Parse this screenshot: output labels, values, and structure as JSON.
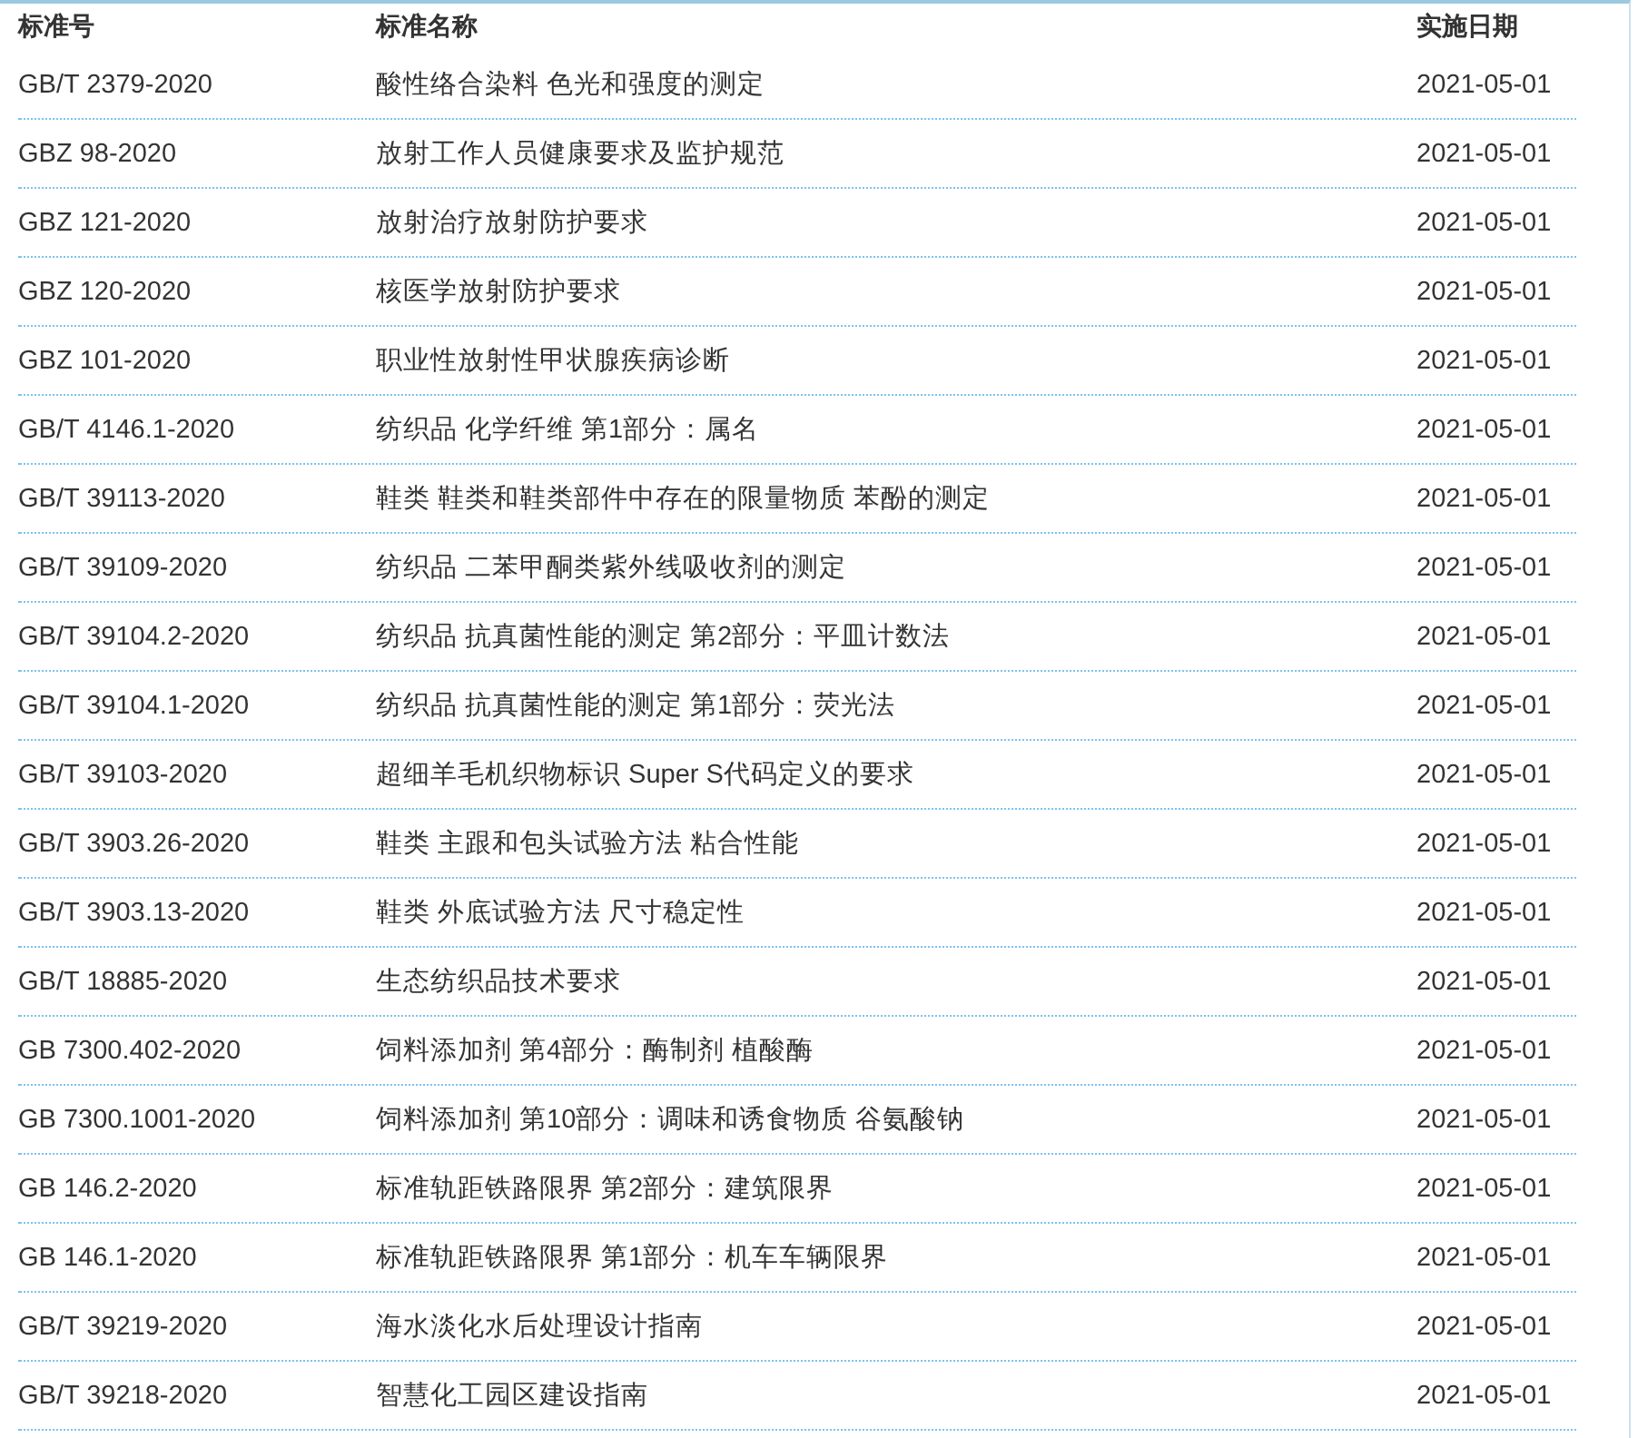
{
  "table": {
    "columns": [
      "标准号",
      "标准名称",
      "实施日期"
    ],
    "rows": [
      [
        "GB/T 2379-2020",
        "酸性络合染料 色光和强度的测定",
        "2021-05-01"
      ],
      [
        "GBZ 98-2020",
        "放射工作人员健康要求及监护规范",
        "2021-05-01"
      ],
      [
        "GBZ 121-2020",
        "放射治疗放射防护要求",
        "2021-05-01"
      ],
      [
        "GBZ 120-2020",
        "核医学放射防护要求",
        "2021-05-01"
      ],
      [
        "GBZ 101-2020",
        "职业性放射性甲状腺疾病诊断",
        "2021-05-01"
      ],
      [
        "GB/T 4146.1-2020",
        "纺织品 化学纤维 第1部分：属名",
        "2021-05-01"
      ],
      [
        "GB/T 39113-2020",
        "鞋类 鞋类和鞋类部件中存在的限量物质 苯酚的测定",
        "2021-05-01"
      ],
      [
        "GB/T 39109-2020",
        "纺织品 二苯甲酮类紫外线吸收剂的测定",
        "2021-05-01"
      ],
      [
        "GB/T 39104.2-2020",
        "纺织品 抗真菌性能的测定 第2部分：平皿计数法",
        "2021-05-01"
      ],
      [
        "GB/T 39104.1-2020",
        "纺织品 抗真菌性能的测定 第1部分：荧光法",
        "2021-05-01"
      ],
      [
        "GB/T 39103-2020",
        "超细羊毛机织物标识 Super S代码定义的要求",
        "2021-05-01"
      ],
      [
        "GB/T 3903.26-2020",
        "鞋类 主跟和包头试验方法 粘合性能",
        "2021-05-01"
      ],
      [
        "GB/T 3903.13-2020",
        "鞋类 外底试验方法 尺寸稳定性",
        "2021-05-01"
      ],
      [
        "GB/T 18885-2020",
        "生态纺织品技术要求",
        "2021-05-01"
      ],
      [
        "GB 7300.402-2020",
        "饲料添加剂 第4部分：酶制剂 植酸酶",
        "2021-05-01"
      ],
      [
        "GB 7300.1001-2020",
        "饲料添加剂 第10部分：调味和诱食物质 谷氨酸钠",
        "2021-05-01"
      ],
      [
        "GB 146.2-2020",
        "标准轨距铁路限界 第2部分：建筑限界",
        "2021-05-01"
      ],
      [
        "GB 146.1-2020",
        "标准轨距铁路限界 第1部分：机车车辆限界",
        "2021-05-01"
      ],
      [
        "GB/T 39219-2020",
        "海水淡化水后处理设计指南",
        "2021-05-01"
      ],
      [
        "GB/T 39218-2020",
        "智慧化工园区建设指南",
        "2021-05-01"
      ]
    ]
  }
}
